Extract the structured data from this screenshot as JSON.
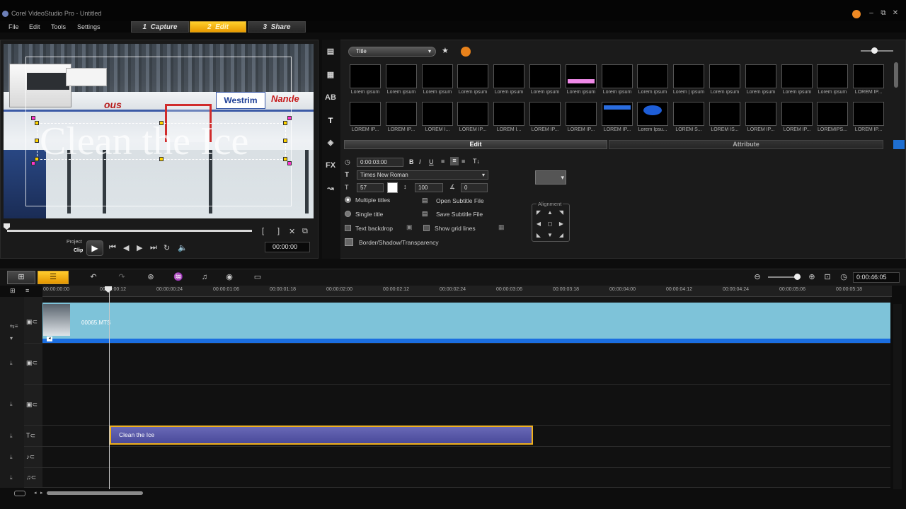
{
  "window": {
    "title": "Corel VideoStudio Pro - Untitled"
  },
  "menu": {
    "items": [
      "File",
      "Edit",
      "Tools",
      "Settings"
    ]
  },
  "steps": [
    {
      "num": "1",
      "label": "Capture",
      "active": false
    },
    {
      "num": "2",
      "label": "Edit",
      "active": true
    },
    {
      "num": "3",
      "label": "Share",
      "active": false
    }
  ],
  "preview": {
    "overlay_text": "Clean the Ice",
    "ads": {
      "westrim": "Westrim",
      "nande": "Nande",
      "ous": "ous"
    },
    "project_label": "Project",
    "clip_label": "Clip",
    "timecode": "00:00:00"
  },
  "library": {
    "category": "Title",
    "thumbs_row1": [
      "Lorem ipsum",
      "Lorem ipsum",
      "Lorem ipsum",
      "Lorem ipsum",
      "Lorem ipsum",
      "Lorem ipsum",
      "Lorem ipsum",
      "Lorem ipsum",
      "Lorem ipsum",
      "Lorem | ipsum",
      "Lorem ipsum",
      "Lorem ipsum",
      "Lorem ipsum",
      "Lorem ipsum",
      "LOREM IP..."
    ],
    "thumbs_row2": [
      "LOREM IP...",
      "LOREM IP...",
      "LOREM I...",
      "LOREM IP...",
      "LOREM I...",
      "LOREM IP...",
      "LOREM IP...",
      "LOREM IP...",
      "Lorem Ipsu...",
      "LOREM S...",
      "LOREM IS...",
      "LOREM IP...",
      "LOREM IP...",
      "LOREMIPS...",
      "LOREM IP..."
    ]
  },
  "options": {
    "edit_tab": "Edit",
    "attribute_tab": "Attribute",
    "duration": "0:00:03:00",
    "font": "Times New Roman",
    "font_size": "57",
    "line_spacing": "100",
    "angle": "0",
    "multiple_titles": "Multiple titles",
    "single_title": "Single title",
    "text_backdrop": "Text backdrop",
    "show_grid_lines": "Show grid lines",
    "border_shadow": "Border/Shadow/Transparency",
    "open_subtitle": "Open Subtitle File",
    "save_subtitle": "Save Subtitle File",
    "alignment": "Alignment"
  },
  "timeline": {
    "timecode": "0:00:46:05",
    "ruler": [
      "00:00:00:00",
      "00:00:00:12",
      "00:00:00:24",
      "00:00:01:06",
      "00:00:01:18",
      "00:00:02:00",
      "00:00:02:12",
      "00:00:02:24",
      "00:00:03:06",
      "00:00:03:18",
      "00:00:04:00",
      "00:00:04:12",
      "00:00:04:24",
      "00:00:05:06",
      "00:00:05:18"
    ],
    "video_clip": "00065.MTS",
    "title_clip": "Clean the Ice"
  }
}
